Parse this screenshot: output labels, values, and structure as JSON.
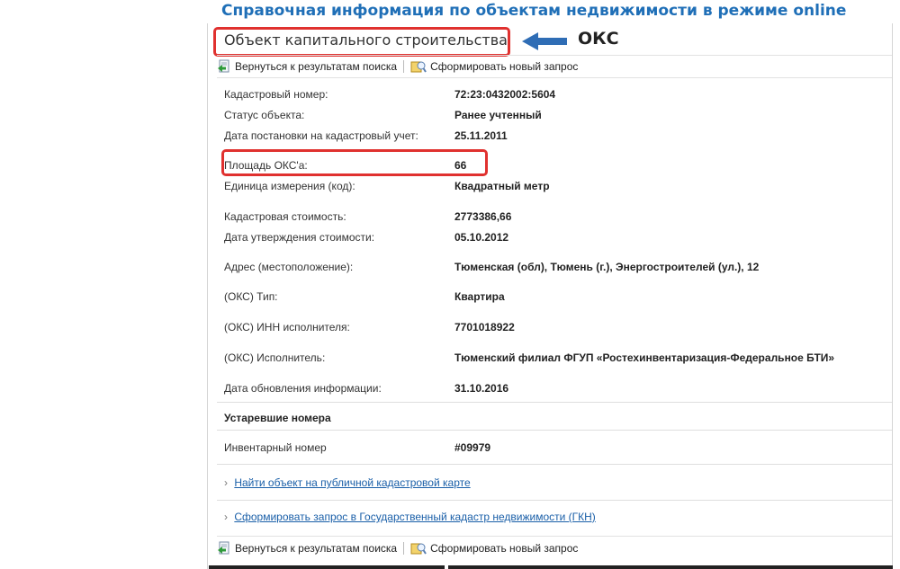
{
  "page": {
    "heading": "Справочная информация по объектам недвижимости в режиме online",
    "object_title": "Объект капитального строительства",
    "callout": "ОКС"
  },
  "toolbar": {
    "back_label": "Вернуться к результатам поиска",
    "new_query_label": "Сформировать новый запрос"
  },
  "fields": [
    {
      "label": "Кадастровый номер:",
      "value": "72:23:0432002:5604"
    },
    {
      "label": "Статус объекта:",
      "value": "Ранее учтенный"
    },
    {
      "label": "Дата постановки на кадастровый учет:",
      "value": "25.11.2011"
    },
    {
      "label": "Площадь ОКС'а:",
      "value": "66"
    },
    {
      "label": "Единица измерения (код):",
      "value": "Квадратный метр"
    },
    {
      "label": "Кадастровая стоимость:",
      "value": "2773386,66"
    },
    {
      "label": "Дата утверждения стоимости:",
      "value": "05.10.2012"
    },
    {
      "label": "Адрес (местоположение):",
      "value": "Тюменская (обл), Тюмень (г.), Энергостроителей (ул.), 12"
    },
    {
      "label": "(ОКС) Тип:",
      "value": "Квартира"
    },
    {
      "label": "(ОКС) ИНН исполнителя:",
      "value": "7701018922"
    },
    {
      "label": "(ОКС) Исполнитель:",
      "value": "Тюменский филиал ФГУП «Ростехинвентаризация-Федеральное БТИ»"
    },
    {
      "label": "Дата обновления информации:",
      "value": "31.10.2016"
    }
  ],
  "obsolete": {
    "heading": "Устаревшие номера",
    "items": [
      {
        "label": "Инвентарный номер",
        "value": "#09979"
      }
    ]
  },
  "links": {
    "public_map": "Найти объект на публичной кадастровой карте",
    "gkn_request": "Сформировать запрос в Государственный кадастр недвижимости (ГКН)",
    "chevron": "›"
  },
  "colors": {
    "heading": "#1f6fb7",
    "highlight": "#e0312f",
    "arrow": "#2f6db5",
    "link": "#1a5fa8"
  }
}
